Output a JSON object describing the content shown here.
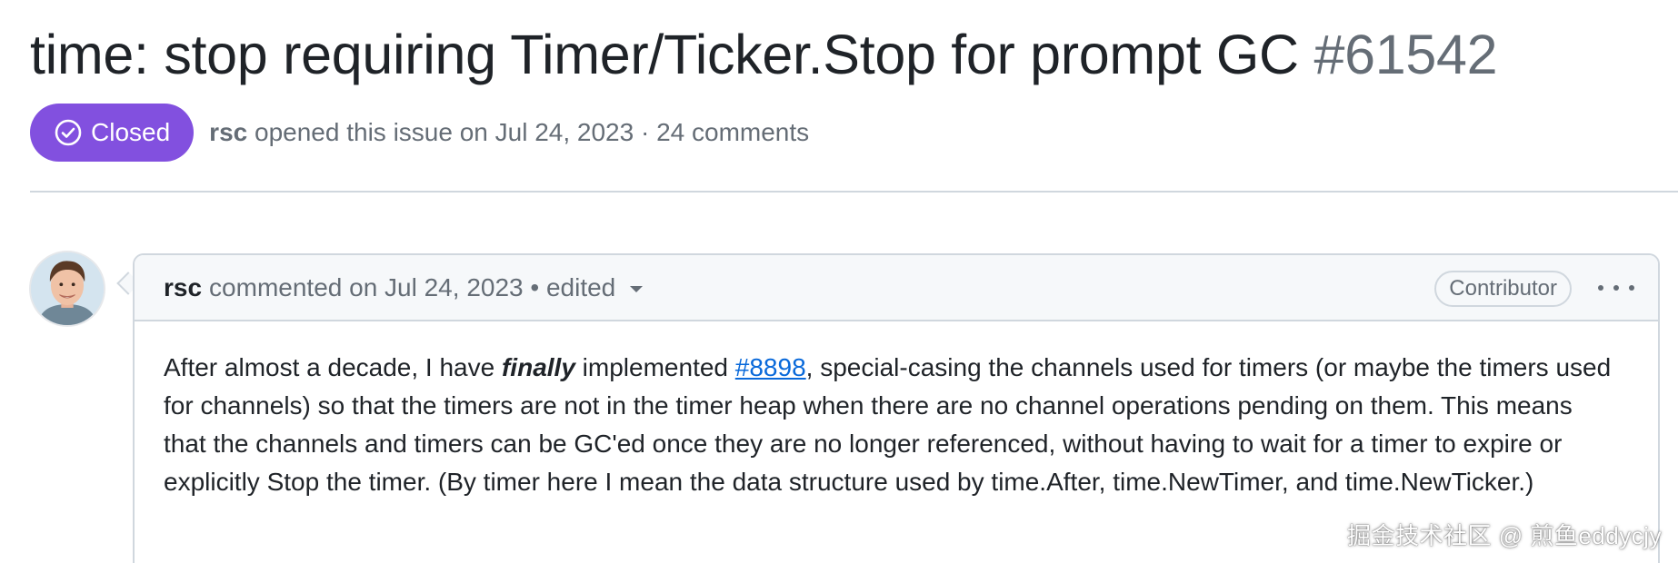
{
  "issue": {
    "title": "time: stop requiring Timer/Ticker.Stop for prompt GC",
    "number": "#61542",
    "state": "Closed",
    "state_color": "#8250df",
    "state_icon": "check-circle-icon",
    "author": "rsc",
    "opened_text": "opened this issue on Jul 24, 2023 · 24 comments"
  },
  "comment": {
    "author": "rsc",
    "header_text": "commented on Jul 24, 2023 • edited",
    "role": "Contributor",
    "more_icon": "kebab-horizontal-icon",
    "body": {
      "part1": "After almost a decade, I have ",
      "emphasis": "finally",
      "part2": " implemented ",
      "link": "#8898",
      "part3": ", special-casing the channels used for timers (or maybe the timers used for channels) so that the timers are not in the timer heap when there are no channel operations pending on them. This means that the channels and timers can be GC'ed once they are no longer referenced, without having to wait for a timer to expire or explicitly Stop the timer. (By timer here I mean the data structure used by time.After, time.NewTimer, and time.NewTicker.)"
    }
  },
  "watermark": "掘金技术社区 @ 煎鱼eddycjy",
  "colors": {
    "link": "#0969da",
    "muted_text": "#656d76",
    "border": "#d0d7de",
    "header_bg": "#f6f8fa"
  }
}
